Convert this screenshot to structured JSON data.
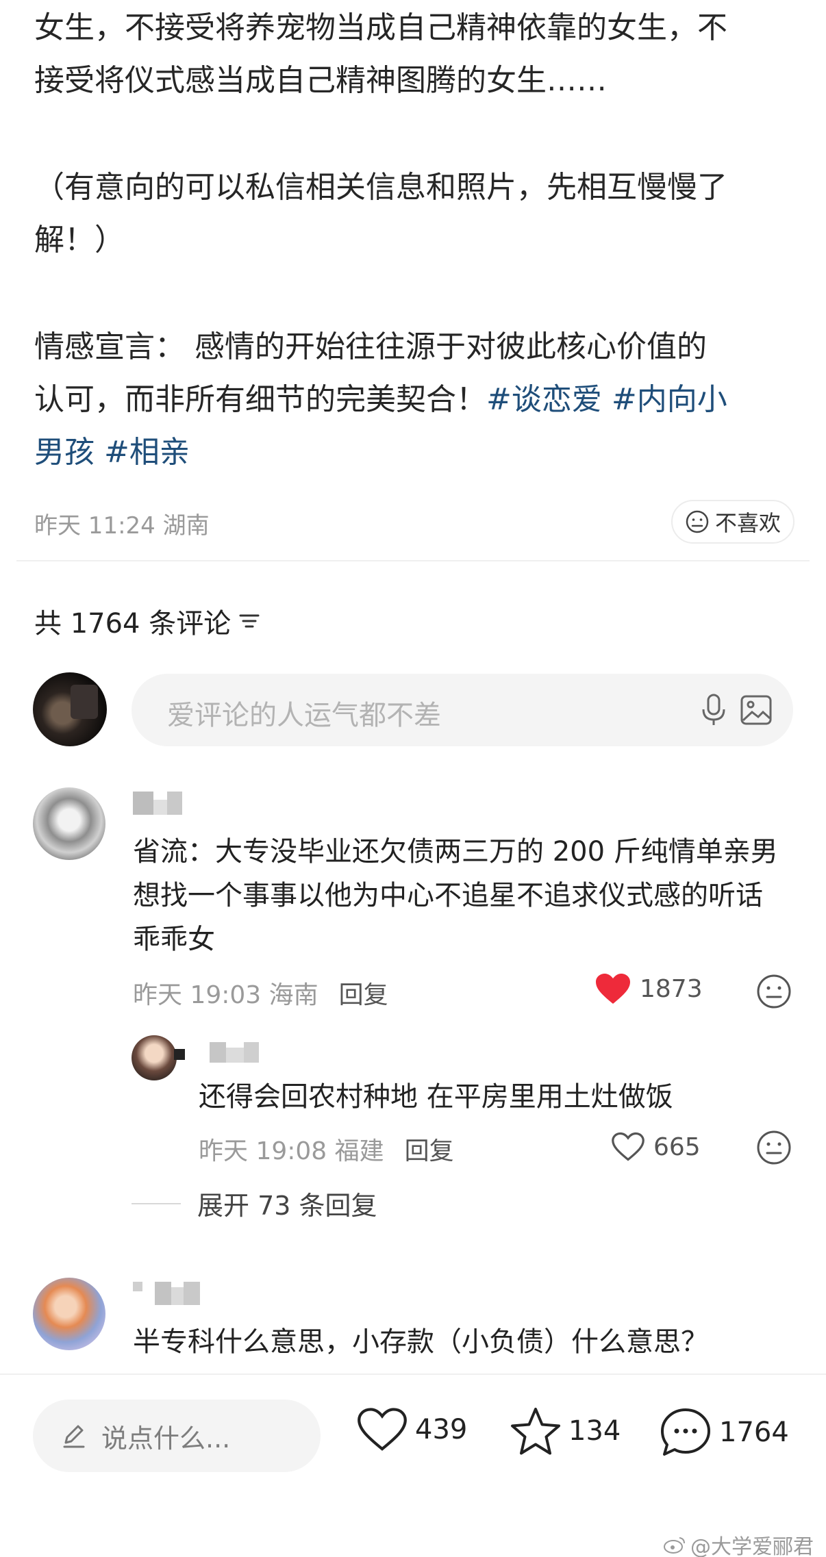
{
  "post": {
    "line1": "女生，不接受将养宠物当成自己精神依靠的女生，不",
    "line2": "接受将仪式感当成自己精神图腾的女生……",
    "line3": "（有意向的可以私信相关信息和照片，先相互慢慢了",
    "line4": "解！）",
    "line5": "情感宣言：   感情的开始往往源于对彼此核心价值的",
    "line6_prefix": "认可，而非所有细节的完美契合！",
    "tag1": "#谈恋爱",
    "tag2_part1": "#内向小",
    "tag2_part2": "男孩",
    "tag3": "#相亲",
    "meta": "昨天 11:24 湖南",
    "dislike_label": "不喜欢"
  },
  "comments_header": {
    "title": "共 1764 条评论"
  },
  "comment_input": {
    "placeholder": "爱评论的人运气都不差"
  },
  "comments": [
    {
      "text_line1": "省流：大专没毕业还欠债两三万的 200 斤纯情单亲男",
      "text_line2": "想找一个事事以他为中心不追星不追求仪式感的听话",
      "text_line3": "乖乖女",
      "meta": "昨天 19:03 海南",
      "reply_label": "回复",
      "likes": "1873",
      "liked": true
    },
    {
      "text_line1": "还得会回农村种地 在平房里用土灶做饭",
      "meta": "昨天 19:08 福建",
      "reply_label": "回复",
      "likes": "665",
      "liked": false
    },
    {
      "text_line1": "半专科什么意思，小存款（小负债）什么意思？"
    }
  ],
  "expand_replies": {
    "label": "展开 73 条回复"
  },
  "bottom_bar": {
    "say_placeholder": "说点什么...",
    "likes": "439",
    "favorites": "134",
    "comments": "1764"
  },
  "watermark": "@大学爱郦君",
  "colors": {
    "tag": "#1f4e7a",
    "like_red": "#ee2a3a",
    "meta_gray": "#9a9a9a"
  }
}
